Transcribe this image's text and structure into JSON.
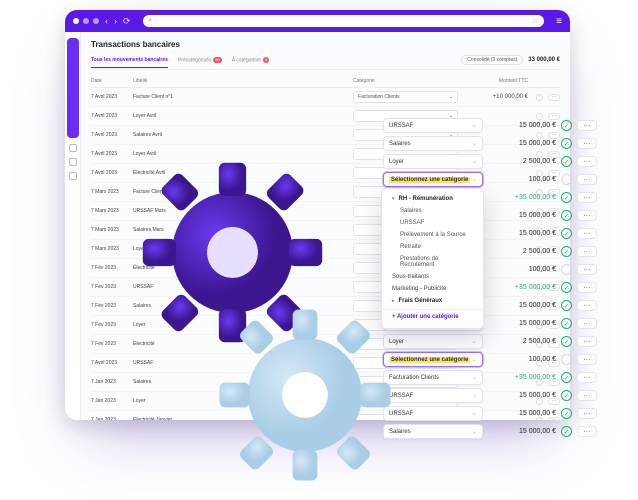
{
  "chrome": {
    "search_icon": "⌕",
    "star_icon": "☆"
  },
  "page_title": "Transactions bancaires",
  "tabs": [
    {
      "label": "Tous les mouvements bancaires",
      "active": true
    },
    {
      "label": "Précatégorisés",
      "badge": "50"
    },
    {
      "label": "À catégoriser",
      "badge": "8"
    }
  ],
  "accounts_control": "Consolidé (3 comptes)",
  "total": "33 000,00 €",
  "columns": {
    "date": "Date",
    "label": "Libellé",
    "category": "Catégorie",
    "amount": "Montant TTC"
  },
  "table_rows": [
    {
      "date": "7 Avril 2023",
      "label": "Facture Client n°1",
      "category": "Facturation Clients",
      "amount": "+10 000,00 €"
    },
    {
      "date": "7 Avril 2023",
      "label": "Loyer Avril"
    },
    {
      "date": "7 Avril 2023",
      "label": "Salaires Avril"
    },
    {
      "date": "7 Avril 2023",
      "label": "Loyer Avril"
    },
    {
      "date": "7 Avril 2023",
      "label": "Électricité Avril"
    },
    {
      "date": "7 Mars 2023",
      "label": "Facture Client n°1"
    },
    {
      "date": "7 Mars 2023",
      "label": "URSSAF Mars"
    },
    {
      "date": "7 Mars 2023",
      "label": "Salaires Mars"
    },
    {
      "date": "7 Mars 2023",
      "label": "Loyer Mars"
    },
    {
      "date": "7 Fév 2023",
      "label": "Électricité"
    },
    {
      "date": "7 Fév 2023",
      "label": "URSSAF"
    },
    {
      "date": "7 Fév 2023",
      "label": "Salaires"
    },
    {
      "date": "7 Fév 2023",
      "label": "Loyer"
    },
    {
      "date": "7 Fév 2023",
      "label": "Électricité"
    },
    {
      "date": "7 Avril 2023",
      "label": "URSSAF"
    },
    {
      "date": "7 Jan 2023",
      "label": "Salaires"
    },
    {
      "date": "7 Jan 2023",
      "label": "Loyer"
    },
    {
      "date": "7 Jan 2023",
      "label": "Électricité Janvier"
    }
  ],
  "cascade": [
    {
      "cat": "URSSAF",
      "amount": "15 000,00 €",
      "ok": true
    },
    {
      "cat": "Salaires",
      "amount": "15 000,00 €",
      "ok": true
    },
    {
      "cat": "Loyer",
      "amount": "2 500,00 €",
      "ok": true
    },
    {
      "cat": "Sélectionnez une catégorie",
      "amount": "100,00 €",
      "hl": true
    },
    {
      "cat": "",
      "amount": "+35 000,00 €",
      "g": true,
      "ok": true
    },
    {
      "cat": "",
      "amount": "15 000,00 €",
      "ok": true
    },
    {
      "cat": "",
      "amount": "15 000,00 €",
      "ok": true
    },
    {
      "cat": "",
      "amount": "2 500,00 €",
      "ok": true
    },
    {
      "cat": "",
      "amount": "100,00 €"
    },
    {
      "cat": "",
      "amount": "+35 000,00 €",
      "g": true,
      "ok": true
    },
    {
      "cat": "",
      "amount": "15 000,00 €",
      "ok": true
    },
    {
      "cat": "Loyer",
      "amount": "15 000,00 €",
      "ok": true
    },
    {
      "cat": "Loyer",
      "amount": "2 500,00 €",
      "ok": true
    },
    {
      "cat": "Sélectionnez une catégorie",
      "amount": "100,00 €",
      "hl": true
    },
    {
      "cat": "Facturation Clients",
      "amount": "+35 000,00 €",
      "g": true,
      "ok": true
    },
    {
      "cat": "URSSAF",
      "amount": "15 000,00 €",
      "ok": true
    },
    {
      "cat": "URSSAF",
      "amount": "15 000,00 €",
      "ok": true
    },
    {
      "cat": "Salaires",
      "amount": "15 000,00 €",
      "ok": true
    }
  ],
  "dropdown": {
    "group": "RH - Rémunération",
    "items": [
      "Salaires",
      "URSSAF",
      "Prélèvement à la Source",
      "Retraite",
      "Prestations de Recrutement"
    ],
    "extra": [
      "Sous-traitants",
      "Marketing - Publicité"
    ],
    "group2": "Frais Généraux",
    "add": "+ Ajouter une catégorie"
  }
}
